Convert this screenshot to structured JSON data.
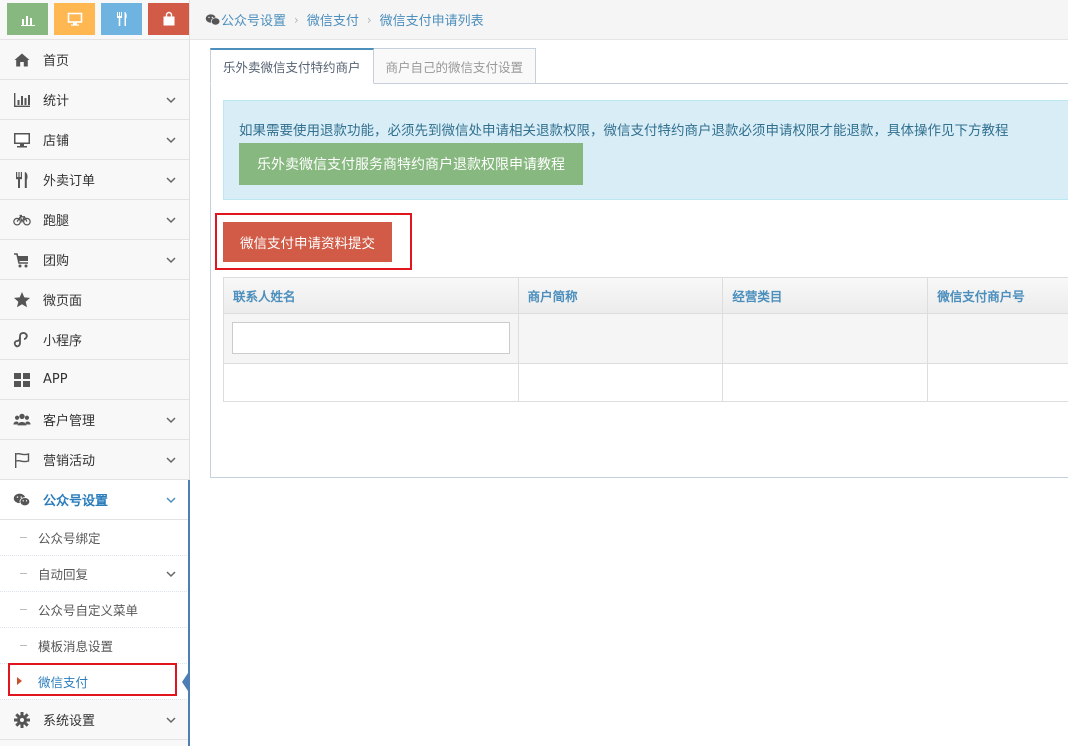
{
  "sidebar": {
    "shortcuts": [
      {
        "icon": "bar-chart-icon",
        "color": "#87b87f"
      },
      {
        "icon": "desktop-icon",
        "color": "#ffb752"
      },
      {
        "icon": "utensils-icon",
        "color": "#6fb3e0"
      },
      {
        "icon": "shopping-bag-icon",
        "color": "#d15b47"
      }
    ],
    "items": [
      {
        "label": "首页",
        "icon": "home-icon",
        "has_children": false
      },
      {
        "label": "统计",
        "icon": "bar-chart-icon",
        "has_children": true
      },
      {
        "label": "店铺",
        "icon": "desktop-icon",
        "has_children": true
      },
      {
        "label": "外卖订单",
        "icon": "utensils-icon",
        "has_children": true
      },
      {
        "label": "跑腿",
        "icon": "bicycle-icon",
        "has_children": true
      },
      {
        "label": "团购",
        "icon": "cart-icon",
        "has_children": true
      },
      {
        "label": "微页面",
        "icon": "star-icon",
        "has_children": false
      },
      {
        "label": "小程序",
        "icon": "mini-program-icon",
        "has_children": false
      },
      {
        "label": "APP",
        "icon": "grid-icon",
        "has_children": false
      },
      {
        "label": "客户管理",
        "icon": "users-icon",
        "has_children": true
      },
      {
        "label": "营销活动",
        "icon": "flag-icon",
        "has_children": true
      },
      {
        "label": "公众号设置",
        "icon": "wechat-icon",
        "has_children": true,
        "active": true
      }
    ],
    "sub_items": [
      {
        "label": "公众号绑定"
      },
      {
        "label": "自动回复",
        "has_children": true
      },
      {
        "label": "公众号自定义菜单"
      },
      {
        "label": "模板消息设置"
      },
      {
        "label": "微信支付",
        "current": true
      }
    ],
    "after_items": [
      {
        "label": "系统设置",
        "icon": "gear-icon",
        "has_children": true
      }
    ]
  },
  "breadcrumb": {
    "icon": "wechat-icon",
    "items": [
      "公众号设置",
      "微信支付",
      "微信支付申请列表"
    ]
  },
  "tabs": [
    {
      "label": "乐外卖微信支付特约商户",
      "active": true
    },
    {
      "label": "商户自己的微信支付设置",
      "active": false
    }
  ],
  "alert": {
    "text": "如果需要使用退款功能，必须先到微信处申请相关退款权限，微信支付特约商户退款必须申请权限才能退款，具体操作见下方教程",
    "button": "乐外卖微信支付服务商特约商户退款权限申请教程"
  },
  "submit_button": "微信支付申请资料提交",
  "table": {
    "columns": [
      "联系人姓名",
      "商户简称",
      "经营类目",
      "微信支付商户号"
    ],
    "filter_placeholder": ""
  },
  "colors": {
    "accent": "#4c8fbd",
    "alert_bg": "#d9edf7",
    "success": "#87b87f",
    "danger": "#d15b47",
    "highlight": "#e0151d"
  }
}
